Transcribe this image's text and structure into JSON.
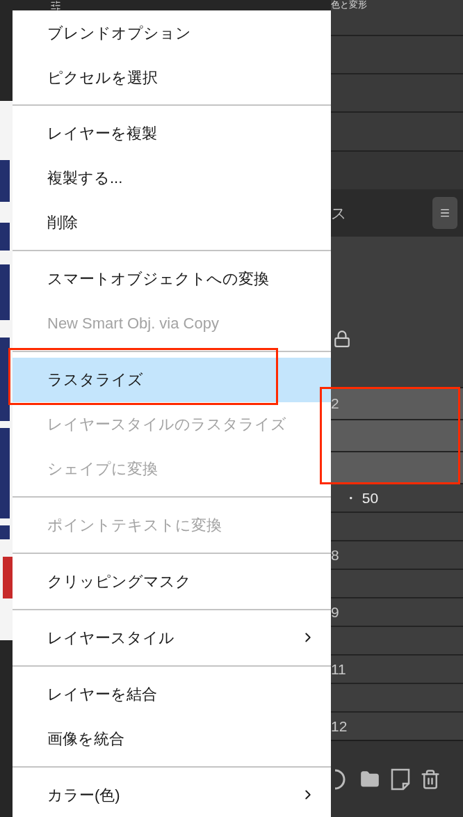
{
  "properties_panel": {
    "title": "色と変形"
  },
  "layers_panel": {
    "title": "ス",
    "rows": [
      {
        "label": "2",
        "highlighted": true
      },
      {
        "highlighted": true
      },
      {
        "highlighted": true
      },
      {
        "label": "・ 50",
        "highlighted": false
      },
      {
        "highlighted": false
      },
      {
        "label": "8",
        "highlighted": false
      },
      {
        "highlighted": false
      },
      {
        "label": "9",
        "highlighted": false
      },
      {
        "highlighted": false
      },
      {
        "label": "11",
        "highlighted": false
      },
      {
        "highlighted": false
      },
      {
        "label": "12",
        "highlighted": false
      }
    ]
  },
  "context_menu": {
    "items": [
      {
        "kind": "item",
        "label": "ブレンドオプション",
        "disabled": false,
        "selected": false
      },
      {
        "kind": "item",
        "label": "ピクセルを選択",
        "disabled": false,
        "selected": false
      },
      {
        "kind": "separator"
      },
      {
        "kind": "item",
        "label": "レイヤーを複製",
        "disabled": false,
        "selected": false
      },
      {
        "kind": "item",
        "label": "複製する...",
        "disabled": false,
        "selected": false
      },
      {
        "kind": "item",
        "label": "削除",
        "disabled": false,
        "selected": false
      },
      {
        "kind": "separator"
      },
      {
        "kind": "item",
        "label": "スマートオブジェクトへの変換",
        "disabled": false,
        "selected": false
      },
      {
        "kind": "item",
        "label": "New Smart Obj. via Copy",
        "disabled": true,
        "selected": false
      },
      {
        "kind": "separator"
      },
      {
        "kind": "item",
        "label": "ラスタライズ",
        "disabled": false,
        "selected": true
      },
      {
        "kind": "item",
        "label": "レイヤースタイルのラスタライズ",
        "disabled": true,
        "selected": false
      },
      {
        "kind": "item",
        "label": "シェイプに変換",
        "disabled": true,
        "selected": false
      },
      {
        "kind": "separator"
      },
      {
        "kind": "item",
        "label": "ポイントテキストに変換",
        "disabled": true,
        "selected": false
      },
      {
        "kind": "separator"
      },
      {
        "kind": "item",
        "label": "クリッピングマスク",
        "disabled": false,
        "selected": false
      },
      {
        "kind": "separator"
      },
      {
        "kind": "submenu",
        "label": "レイヤースタイル",
        "disabled": false,
        "selected": false
      },
      {
        "kind": "separator"
      },
      {
        "kind": "item",
        "label": "レイヤーを結合",
        "disabled": false,
        "selected": false
      },
      {
        "kind": "item",
        "label": "画像を統合",
        "disabled": false,
        "selected": false
      },
      {
        "kind": "separator"
      },
      {
        "kind": "submenu",
        "label": "カラー(色)",
        "disabled": false,
        "selected": false
      }
    ]
  },
  "annotation_boxes": {
    "on_menu": true,
    "on_layers": true
  }
}
